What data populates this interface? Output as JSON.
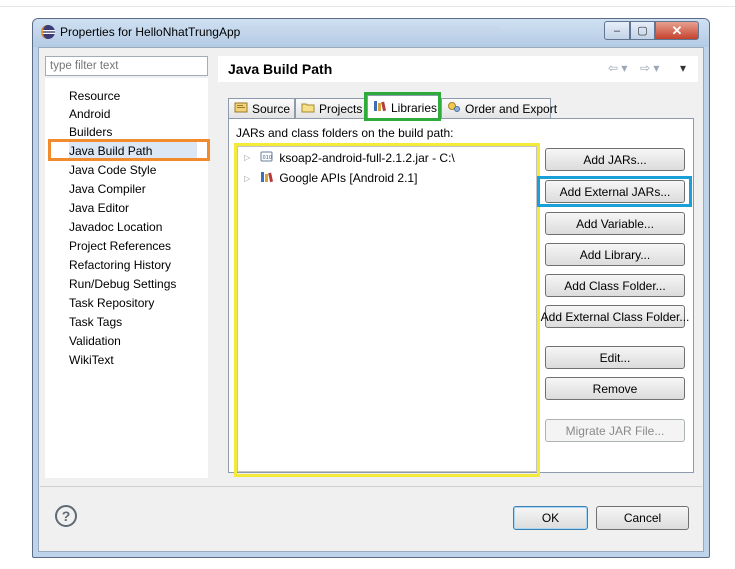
{
  "window": {
    "title": "Properties for HelloNhatTrungApp",
    "minimize_glyph": "‒",
    "maximize_glyph": "▢",
    "close_glyph": "✕"
  },
  "filter": {
    "placeholder": "type filter text"
  },
  "nav": {
    "items": [
      "Resource",
      "Android",
      "Builders",
      "Java Build Path",
      "Java Code Style",
      "Java Compiler",
      "Java Editor",
      "Javadoc Location",
      "Project References",
      "Refactoring History",
      "Run/Debug Settings",
      "Task Repository",
      "Task Tags",
      "Validation",
      "WikiText"
    ],
    "selected": "Java Build Path"
  },
  "page": {
    "title": "Java Build Path",
    "back_glyph": "⇦ ▾",
    "forward_glyph": "⇨ ▾",
    "menu_glyph": "▾"
  },
  "tabs": {
    "source": "Source",
    "projects": "Projects",
    "libraries": "Libraries",
    "order": "Order and Export",
    "active": "Libraries"
  },
  "libraries": {
    "label": "JARs and class folders on the build path:",
    "entries": [
      {
        "label": "ksoap2-android-full-2.1.2.jar - C:\\",
        "icon": "jar-icon"
      },
      {
        "label": "Google APIs [Android 2.1]",
        "icon": "library-icon"
      }
    ]
  },
  "buttons": {
    "add_jars": "Add JARs...",
    "add_external_jars": "Add External JARs...",
    "add_variable": "Add Variable...",
    "add_library": "Add Library...",
    "add_class_folder": "Add Class Folder...",
    "add_external_class_folder": "Add External Class Folder...",
    "edit": "Edit...",
    "remove": "Remove",
    "migrate_jar": "Migrate JAR File..."
  },
  "footer": {
    "help_glyph": "?",
    "ok": "OK",
    "cancel": "Cancel"
  },
  "colors": {
    "highlight_nav": "#f28a2e",
    "highlight_tab": "#2eab3b",
    "highlight_list": "#f4ea3a",
    "highlight_button": "#1aa0d8"
  }
}
